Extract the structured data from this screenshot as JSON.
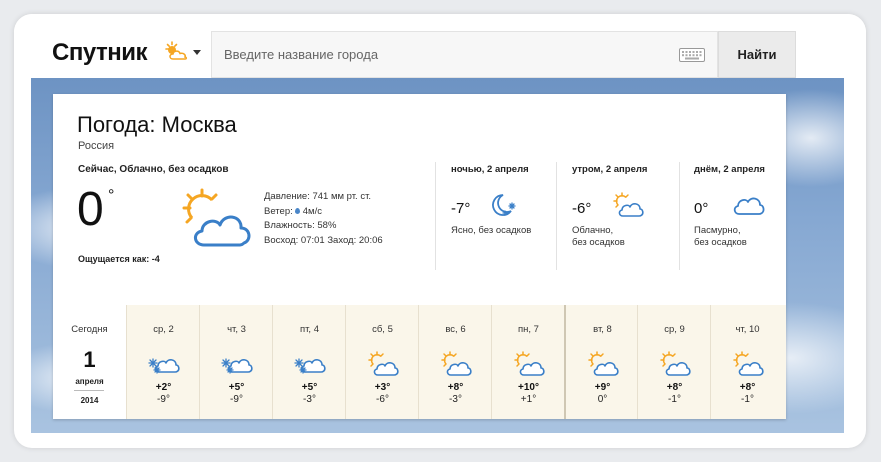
{
  "header": {
    "logo_text": "Спутник",
    "search_placeholder": "Введите название города",
    "search_button": "Найти"
  },
  "city": {
    "title": "Погода: Москва",
    "country": "Россия"
  },
  "current": {
    "label": "Сейчас, Облачно, без осадков",
    "temp": "0",
    "deg": "°",
    "feels_like": "Ощущается как: -4",
    "pressure": "Давление: 741 мм рт. ст.",
    "wind_label": "Ветер:",
    "wind_value": "4м/с",
    "humidity": "Влажность: 58%",
    "sun": "Восход: 07:01 Заход: 20:06",
    "icon": "sun-cloud-icon"
  },
  "parts": [
    {
      "label": "ночью, 2 апреля",
      "temp": "-7°",
      "desc1": "Ясно, без осадков",
      "desc2": "",
      "icon": "moon-snow-icon"
    },
    {
      "label": "утром, 2 апреля",
      "temp": "-6°",
      "desc1": "Облачно,",
      "desc2": "без осадков",
      "icon": "sun-cloud-icon"
    },
    {
      "label": "днём, 2 апреля",
      "temp": "0°",
      "desc1": "Пасмурно,",
      "desc2": "без осадков",
      "icon": "cloud-icon"
    }
  ],
  "today": {
    "label": "Сегодня",
    "day": "1",
    "month": "апреля",
    "year": "2014"
  },
  "days": [
    {
      "label": "ср, 2",
      "hi": "+2°",
      "lo": "-9°",
      "icon": "snow-cloud-icon"
    },
    {
      "label": "чт, 3",
      "hi": "+5°",
      "lo": "-9°",
      "icon": "snow-cloud-icon"
    },
    {
      "label": "пт, 4",
      "hi": "+5°",
      "lo": "-3°",
      "icon": "snow-cloud-icon"
    },
    {
      "label": "сб, 5",
      "hi": "+3°",
      "lo": "-6°",
      "icon": "sun-cloud-icon"
    },
    {
      "label": "вс, 6",
      "hi": "+8°",
      "lo": "-3°",
      "icon": "sun-cloud-icon"
    },
    {
      "label": "пн, 7",
      "hi": "+10°",
      "lo": "+1°",
      "icon": "sun-cloud-icon"
    },
    {
      "label": "вт, 8",
      "hi": "+9°",
      "lo": "0°",
      "icon": "sun-cloud-icon"
    },
    {
      "label": "ср, 9",
      "hi": "+8°",
      "lo": "-1°",
      "icon": "sun-cloud-icon"
    },
    {
      "label": "чт, 10",
      "hi": "+8°",
      "lo": "-1°",
      "icon": "sun-cloud-icon"
    }
  ],
  "colors": {
    "sun": "#f5a623",
    "cloud_stroke": "#3a7fc8",
    "snow": "#3a7fc8",
    "forecast_bg": "#faf6ea"
  }
}
